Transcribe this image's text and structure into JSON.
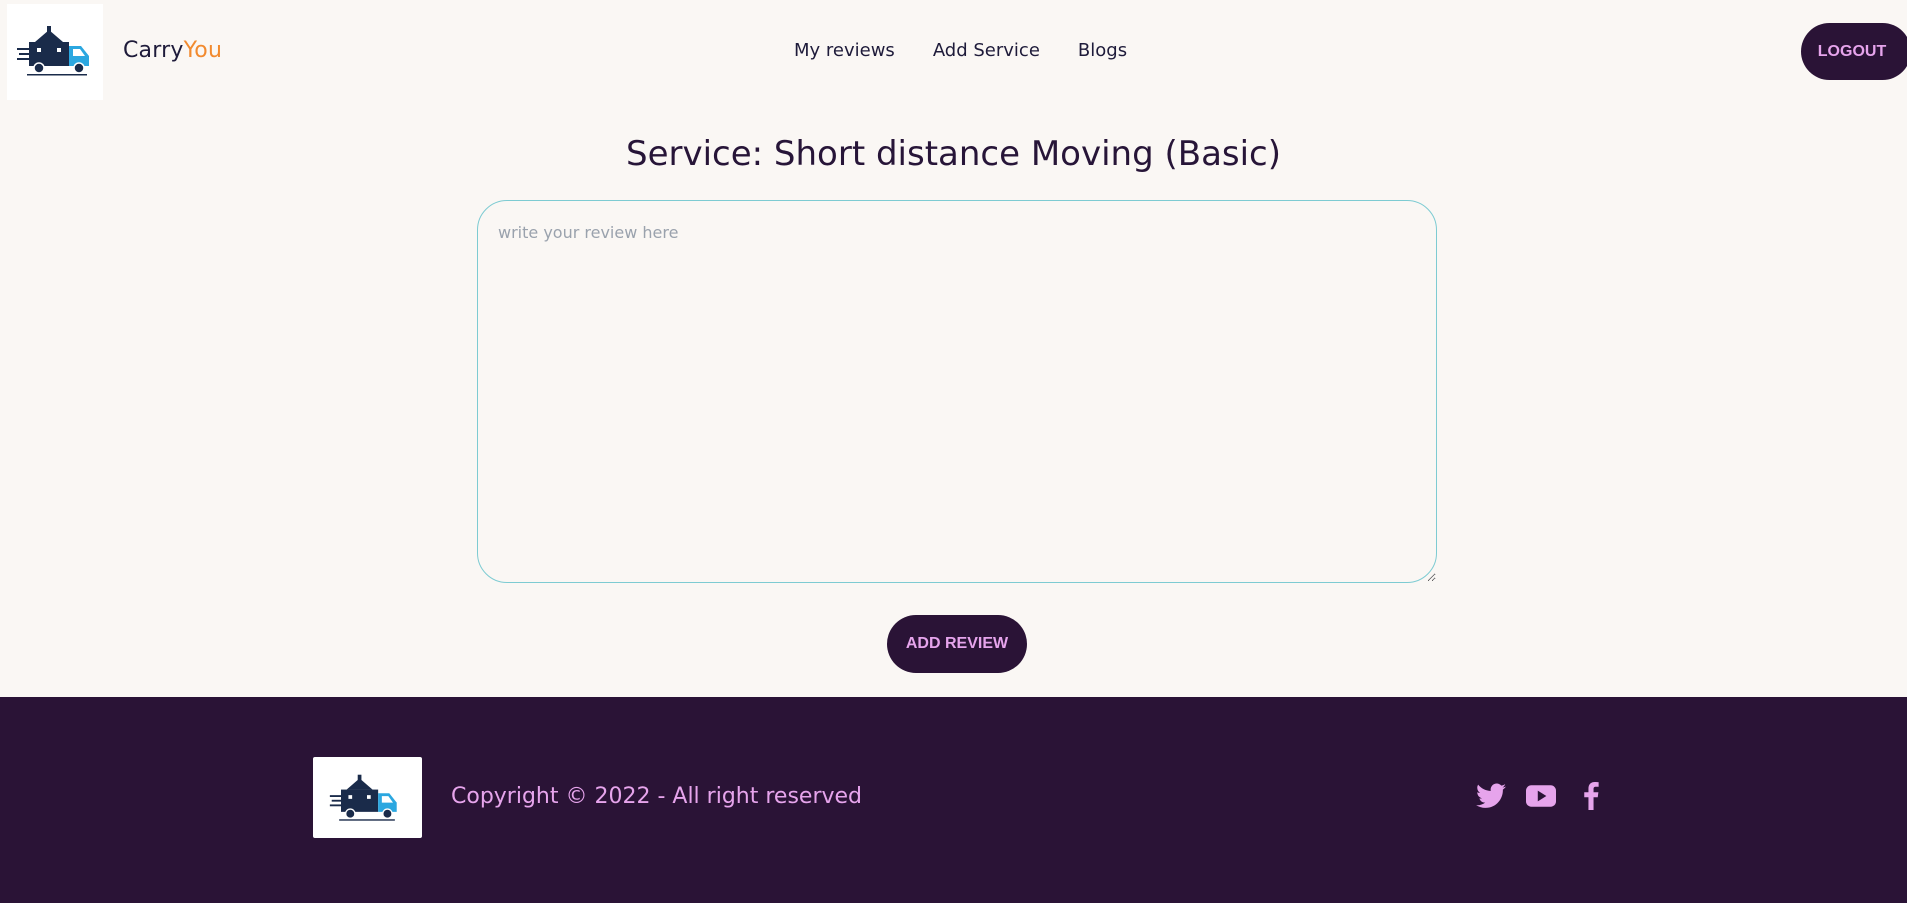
{
  "header": {
    "brand_primary": "Carry",
    "brand_accent": "You",
    "nav": [
      {
        "label": "My reviews"
      },
      {
        "label": "Add Service"
      },
      {
        "label": "Blogs"
      }
    ],
    "logout_label": "LOGOUT"
  },
  "main": {
    "title": "Service: Short distance Moving (Basic)",
    "review_placeholder": "write your review here",
    "review_value": "",
    "submit_label": "ADD REVIEW"
  },
  "footer": {
    "copyright": "Copyright © 2022 - All right reserved",
    "social_icons": [
      "twitter-icon",
      "youtube-icon",
      "facebook-icon"
    ]
  },
  "colors": {
    "page_bg": "#faf7f4",
    "dark_purple": "#2a1336",
    "pink_accent": "#e6a4ec",
    "brand_orange": "#f28a2e",
    "input_border": "#7dcbd2"
  }
}
